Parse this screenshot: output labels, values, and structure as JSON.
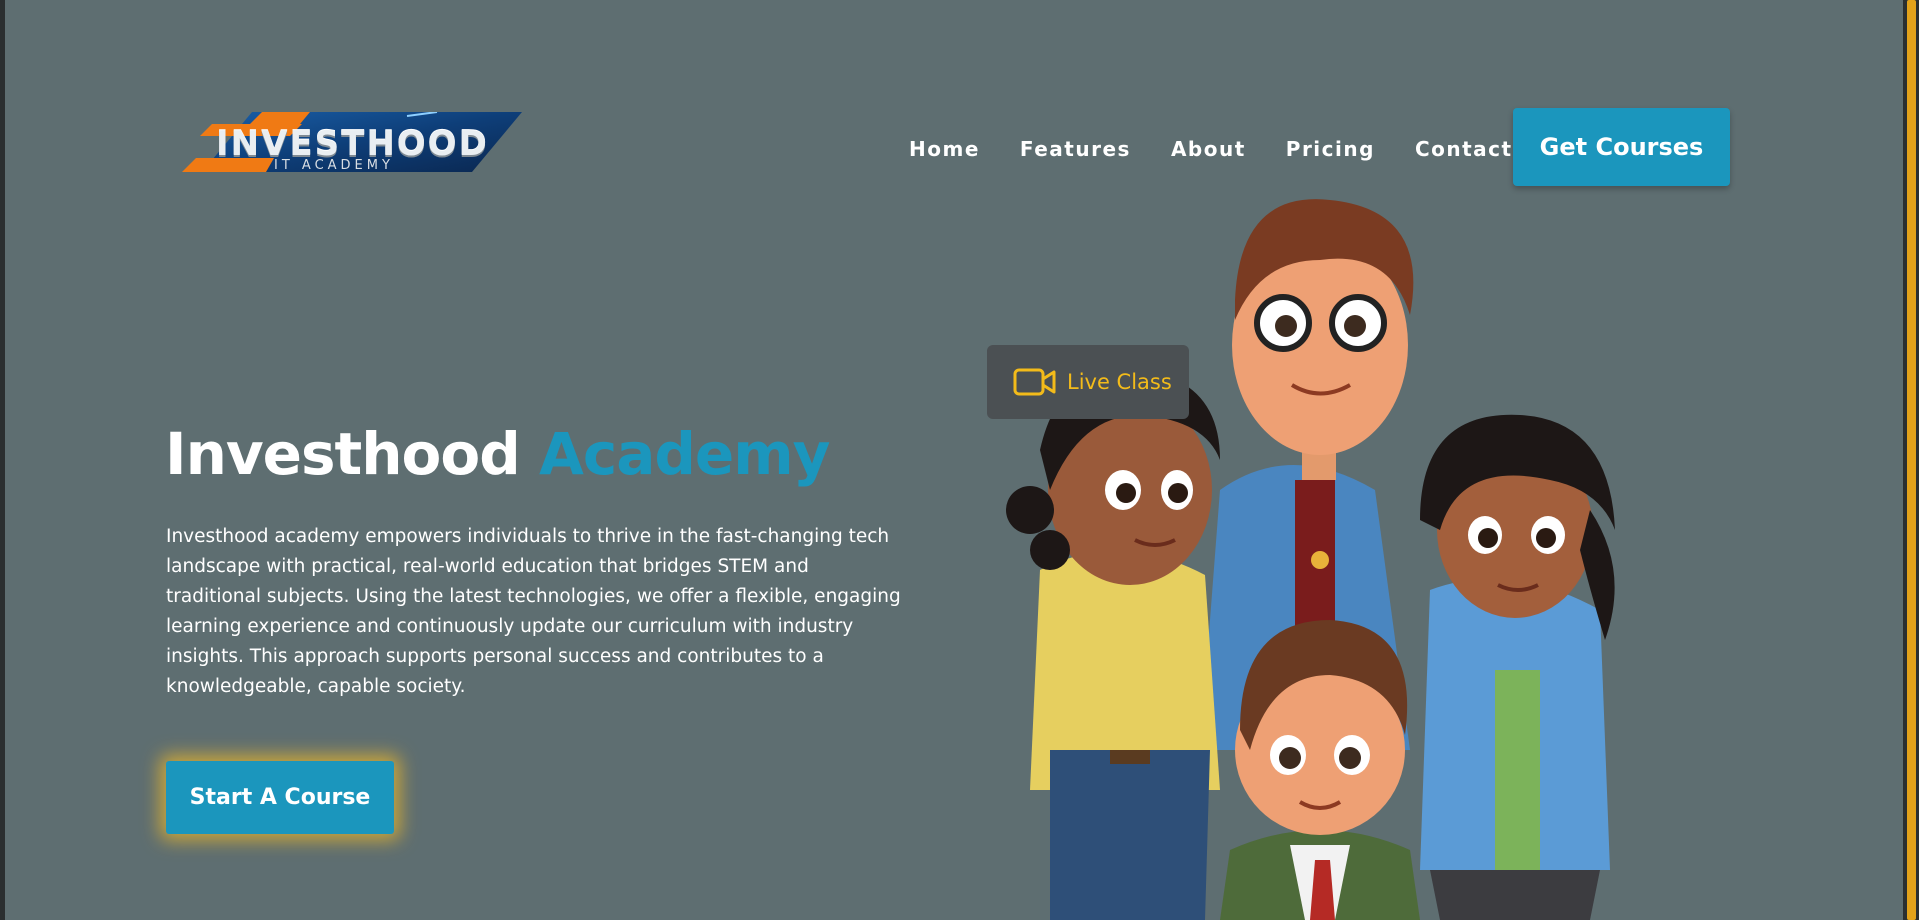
{
  "brand": {
    "logo_text": "INVESTHOOD",
    "logo_subtext": "IT ACADEMY"
  },
  "nav": {
    "items": [
      {
        "label": "Home"
      },
      {
        "label": "Features"
      },
      {
        "label": "About"
      },
      {
        "label": "Pricing"
      },
      {
        "label": "Contact"
      }
    ],
    "cta_label": "Get Courses"
  },
  "hero": {
    "title_main": "Investhood",
    "title_accent": "Academy",
    "description": "Investhood academy empowers individuals to thrive in the fast-changing tech landscape with practical, real-world education that bridges STEM and traditional subjects. Using the latest technologies, we offer a flexible, engaging learning experience and continuously update our curriculum with industry insights. This approach supports personal success and contributes to a knowledgeable, capable society.",
    "cta_label": "Start A Course"
  },
  "badge": {
    "label": "Live Class",
    "icon": "video-camera-icon"
  },
  "colors": {
    "background": "#5e6e71",
    "accent": "#1b96bd",
    "highlight": "#f3bb1a",
    "badge_bg": "#4b5053"
  }
}
